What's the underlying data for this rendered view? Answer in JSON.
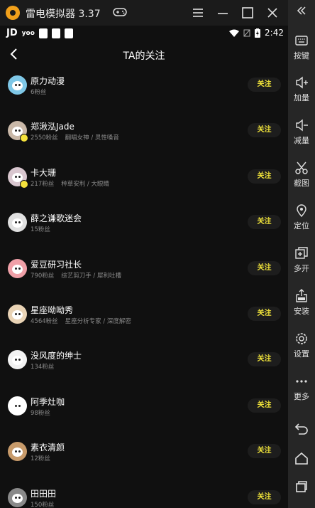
{
  "window": {
    "title": "雷电模拟器 3.37"
  },
  "statusbar": {
    "carrier1": "JD",
    "carrier2": "yoo",
    "time": "2:42"
  },
  "header": {
    "title": "TA的关注"
  },
  "follow_label": "关注",
  "list": [
    {
      "name": "原力动漫",
      "fans": "6粉丝",
      "tags": "",
      "avatar_color": "#7ec7e6"
    },
    {
      "name": "郑湫泓Jade",
      "fans": "2550粉丝",
      "tags": "翻唱女神 / 灵性嗓音",
      "avatar_color": "#c9b8a8"
    },
    {
      "name": "卡大珊",
      "fans": "217粉丝",
      "tags": "种草安利 / 大眼睛",
      "avatar_color": "#d9c7cf"
    },
    {
      "name": "薛之谦歌迷会",
      "fans": "15粉丝",
      "tags": "",
      "avatar_color": "#e0e0e0"
    },
    {
      "name": "爱豆研习社长",
      "fans": "790粉丝",
      "tags": "综艺剪刀手 / 犀利吐槽",
      "avatar_color": "#f0a0a8"
    },
    {
      "name": "星座呦呦秀",
      "fans": "4564粉丝",
      "tags": "星座分析专家 / 深度解密",
      "avatar_color": "#e9d3b5"
    },
    {
      "name": "没风度的绅士",
      "fans": "134粉丝",
      "tags": "",
      "avatar_color": "#f2f2f2"
    },
    {
      "name": "阿季灶咖",
      "fans": "98粉丝",
      "tags": "",
      "avatar_color": "#ffffff"
    },
    {
      "name": "素衣清颜",
      "fans": "12粉丝",
      "tags": "",
      "avatar_color": "#c79a6a"
    },
    {
      "name": "田田田",
      "fans": "150粉丝",
      "tags": "",
      "avatar_color": "#8a8a8a"
    }
  ],
  "sidebar": [
    {
      "label": "按键",
      "icon": "keyboard-icon"
    },
    {
      "label": "加量",
      "icon": "volume-up-icon"
    },
    {
      "label": "减量",
      "icon": "volume-down-icon"
    },
    {
      "label": "截图",
      "icon": "scissors-icon"
    },
    {
      "label": "定位",
      "icon": "location-icon"
    },
    {
      "label": "多开",
      "icon": "multi-open-icon"
    },
    {
      "label": "安装",
      "icon": "apk-install-icon"
    },
    {
      "label": "设置",
      "icon": "gear-icon"
    },
    {
      "label": "更多",
      "icon": "more-icon"
    }
  ]
}
